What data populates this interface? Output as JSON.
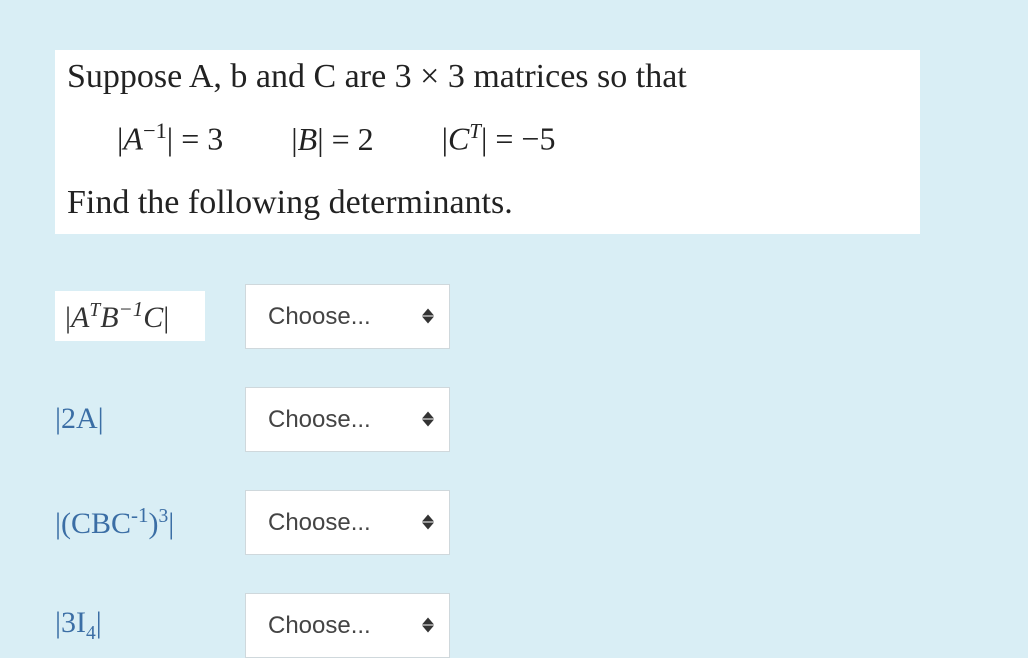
{
  "problem": {
    "intro": "Suppose A, b and C are 3 × 3 matrices so that",
    "eq1_lhs": "|A⁻¹|",
    "eq1_rhs": "= 3",
    "eq2_lhs": "|B|",
    "eq2_rhs": "= 2",
    "eq3_lhs": "|Cᵀ|",
    "eq3_rhs": "= −5",
    "instruction": "Find the following determinants."
  },
  "questions": [
    {
      "label_html": "|AᵀB⁻¹C|",
      "style": "boxed"
    },
    {
      "label_html": "|2A|",
      "style": "plain"
    },
    {
      "label_html": "|(CBC⁻¹)³|",
      "style": "plain"
    },
    {
      "label_html": "|3I₄|",
      "style": "plain"
    }
  ],
  "dropdown": {
    "placeholder": "Choose..."
  }
}
